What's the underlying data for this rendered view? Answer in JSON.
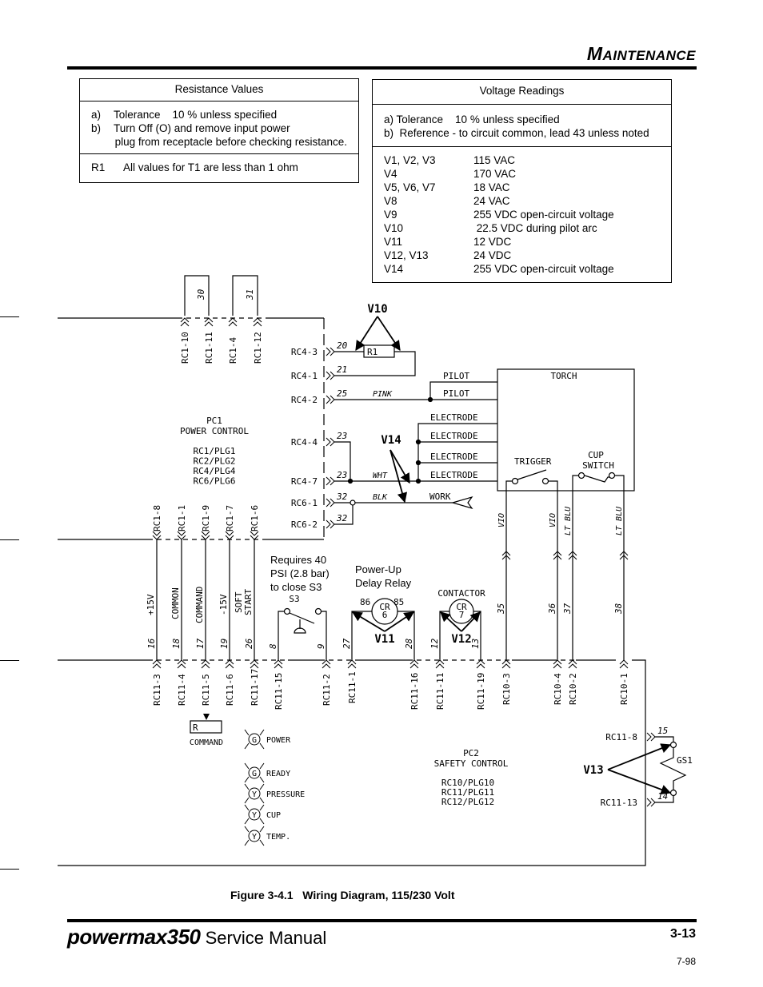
{
  "header": {
    "section_first": "M",
    "section_rest": "AINTENANCE"
  },
  "resistance_table": {
    "title": "Resistance Values",
    "notes": [
      {
        "key": "a)",
        "text": "Tolerance    10 % unless specified"
      },
      {
        "key": "b)",
        "text": "Turn Off (O) and remove input power"
      },
      {
        "key": "",
        "text": " plug from receptacle before checking resistance."
      }
    ],
    "values": [
      {
        "key": "R1",
        "text": "All values for T1 are less than 1 ohm"
      }
    ]
  },
  "voltage_table": {
    "title": "Voltage Readings",
    "notes": [
      "a) Tolerance    10 % unless specified",
      "b)  Reference - to circuit common, lead 43 unless noted"
    ],
    "readings": [
      {
        "point": "V1, V2, V3",
        "value": "115 VAC"
      },
      {
        "point": "V4",
        "value": "170 VAC"
      },
      {
        "point": "V5, V6, V7",
        "value": "18 VAC"
      },
      {
        "point": "V8",
        "value": "24 VAC"
      },
      {
        "point": "V9",
        "value": "255 VDC open-circuit voltage"
      },
      {
        "point": "V10",
        "value": " 22.5 VDC during pilot arc"
      },
      {
        "point": "V11",
        "value": "12 VDC"
      },
      {
        "point": "V12, V13",
        "value": "24 VDC"
      },
      {
        "point": "V14",
        "value": "255 VDC open-circuit voltage"
      }
    ]
  },
  "diagram": {
    "pc1": {
      "title": "PC1",
      "subtitle": "POWER CONTROL",
      "plugs": [
        "RC1/PLG1",
        "RC2/PLG2",
        "RC4/PLG4",
        "RC6/PLG6"
      ]
    },
    "pc2": {
      "title": "PC2",
      "subtitle": "SAFETY CONTROL",
      "plugs": [
        "RC10/PLG10",
        "RC11/PLG11",
        "RC12/PLG12"
      ]
    },
    "top_connectors": [
      {
        "label": "RC1-10"
      },
      {
        "label": "RC1-11",
        "wire": "30"
      },
      {
        "label": "RC1-4"
      },
      {
        "label": "RC1-12",
        "wire": "31"
      }
    ],
    "rc4_connectors": [
      {
        "label": "RC4-3",
        "wire": "20"
      },
      {
        "label": "RC4-1",
        "wire": "21"
      },
      {
        "label": "RC4-2",
        "wire": "25",
        "color": "PINK"
      },
      {
        "label": "RC4-4",
        "wire": "23"
      },
      {
        "label": "RC4-7",
        "wire": "23",
        "color": "WHT"
      },
      {
        "label": "RC6-1",
        "wire": "32",
        "color": "BLK"
      },
      {
        "label": "RC6-2",
        "wire": "32"
      }
    ],
    "resistor": "R1",
    "torch": {
      "title": "TORCH",
      "leads": [
        "PILOT",
        "PILOT",
        "ELECTRODE",
        "ELECTRODE",
        "ELECTRODE",
        "ELECTRODE"
      ],
      "work": "WORK",
      "trigger": "TRIGGER",
      "cup_switch": [
        "CUP",
        "SWITCH"
      ]
    },
    "rc1_bottom": [
      {
        "label": "RC1-8",
        "signal": "+15V",
        "wire": "16",
        "rc11": "RC11-3"
      },
      {
        "label": "RC1-1",
        "signal": "COMMON",
        "wire": "18",
        "rc11": "RC11-4"
      },
      {
        "label": "RC1-9",
        "signal": "COMMAND",
        "wire": "17",
        "rc11": "RC11-5"
      },
      {
        "label": "RC1-7",
        "signal": "-15V",
        "wire": "19",
        "rc11": "RC11-6"
      },
      {
        "label": "RC1-6",
        "signal": "SOFT START",
        "wire": "26",
        "rc11": "RC11-17"
      }
    ],
    "s3": {
      "label": "S3",
      "note": [
        "Requires 40",
        "PSI (2.8 bar)",
        "to close S3"
      ],
      "wires": [
        "8",
        "9"
      ],
      "connectors": [
        "RC11-15",
        "RC11-2"
      ]
    },
    "cr6": {
      "note": [
        "Power-Up",
        "Delay Relay"
      ],
      "label": [
        "CR",
        "6"
      ],
      "pins": [
        "86",
        "85"
      ],
      "wires": [
        "27",
        "28"
      ],
      "connectors": [
        "RC11-1",
        "RC11-16"
      ]
    },
    "cr7": {
      "note": "CONTACTOR",
      "label": [
        "CR",
        "7"
      ],
      "wires": [
        "12",
        "13"
      ],
      "connectors": [
        "RC11-11",
        "RC11-19"
      ]
    },
    "rc10": [
      {
        "label": "RC10-3",
        "wire": "35",
        "color": "VIO"
      },
      {
        "label": "RC10-4",
        "wire": "36",
        "color": "VIO"
      },
      {
        "label": "RC10-2",
        "wire": "37",
        "color": "LT BLU"
      },
      {
        "label": "RC10-1",
        "wire": "38",
        "color": "LT BLU"
      }
    ],
    "command_pot": {
      "label": "R",
      "caption": "COMMAND"
    },
    "leds": [
      {
        "letter": "G",
        "label": "POWER"
      },
      {
        "letter": "G",
        "label": "READY"
      },
      {
        "letter": "Y",
        "label": "PRESSURE"
      },
      {
        "letter": "Y",
        "label": "CUP"
      },
      {
        "letter": "Y",
        "label": "TEMP."
      }
    ],
    "gs1": {
      "label": "GS1",
      "connectors": [
        {
          "label": "RC11-8",
          "wire": "15"
        },
        {
          "label": "RC11-13",
          "wire": "14"
        }
      ]
    },
    "test_points": [
      "V10",
      "V14",
      "V11",
      "V12",
      "V13"
    ]
  },
  "figure_caption": "Figure 3-4.1   Wiring Diagram, 115/230 Volt",
  "footer": {
    "brand": "powermax350",
    "title": "Service Manual",
    "page": "3-13",
    "date": "7-98"
  }
}
